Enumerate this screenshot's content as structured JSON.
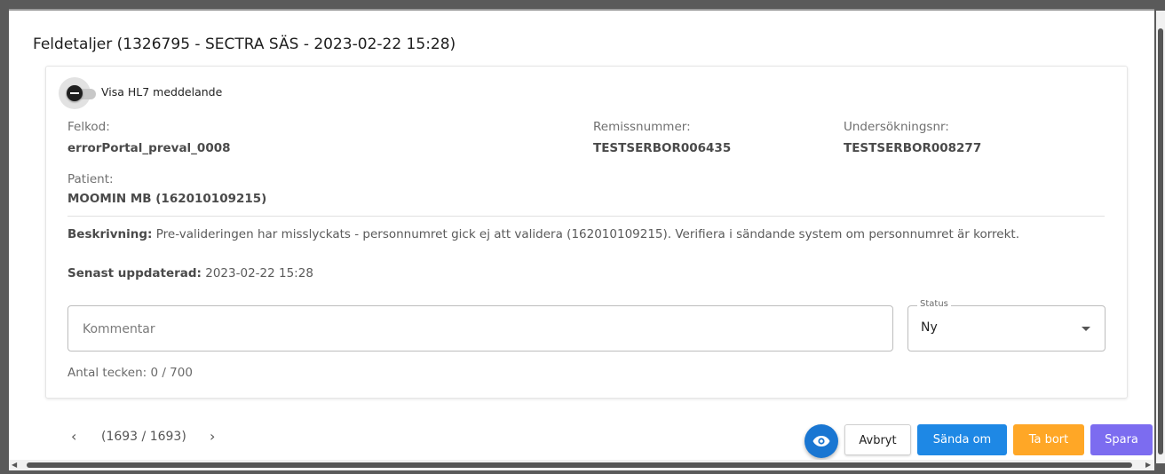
{
  "dialog": {
    "title": "Feldetaljer (1326795 - SECTRA SÄS - 2023-02-22 15:28)"
  },
  "toggle": {
    "label": "Visa HL7 meddelande",
    "checked": false
  },
  "fields": {
    "felkod": {
      "label": "Felkod:",
      "value": "errorPortal_preval_0008"
    },
    "remissnummer": {
      "label": "Remissnummer:",
      "value": "TESTSERBOR006435"
    },
    "undersokningsnr": {
      "label": "Undersökningsnr:",
      "value": "TESTSERBOR008277"
    },
    "patient": {
      "label": "Patient:",
      "value": "MOOMIN MB (162010109215)"
    }
  },
  "description": {
    "label": "Beskrivning:",
    "text": "Pre-valideringen har misslyckats - personnumret gick ej att validera (162010109215). Verifiera i sändande system om personnumret är korrekt."
  },
  "updated": {
    "label": "Senast uppdaterad:",
    "value": "2023-02-22 15:28"
  },
  "comment": {
    "placeholder": "Kommentar",
    "value": ""
  },
  "status": {
    "legend": "Status",
    "selected": "Ny"
  },
  "char_count": "Antal tecken: 0 / 700",
  "pager": {
    "prev": "‹",
    "text": "(1693 / 1693)",
    "next": "›"
  },
  "actions": {
    "view_icon": "eye-icon",
    "cancel": "Avbryt",
    "resend": "Sända om",
    "delete": "Ta bort",
    "save": "Spara"
  },
  "colors": {
    "primary": "#1e88e5",
    "eye": "#1976d2",
    "delete": "#ffa726",
    "save": "#7c6cf0"
  }
}
